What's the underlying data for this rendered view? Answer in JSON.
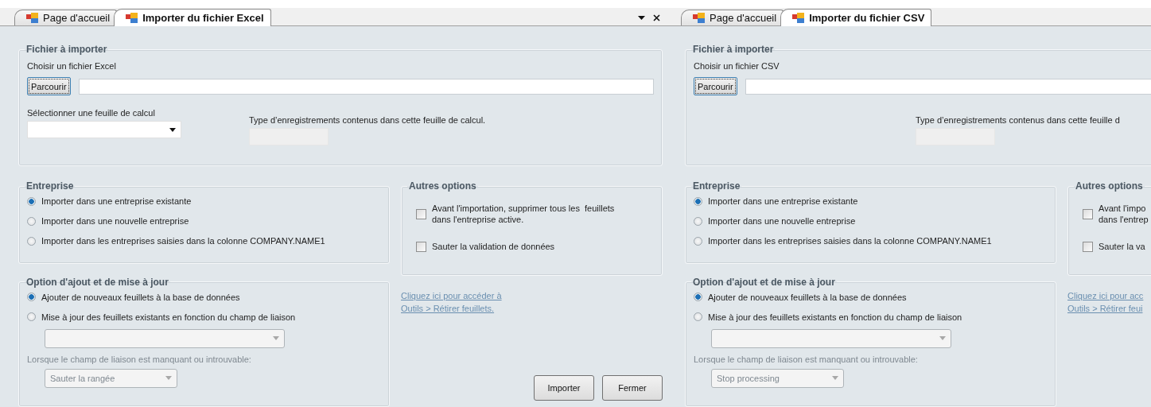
{
  "panels": [
    {
      "tabs": [
        {
          "label": "Page d'accueil",
          "selected": false
        },
        {
          "label": "Importer du fichier Excel",
          "selected": true
        }
      ],
      "tab_controls": true,
      "file_group": {
        "title": "Fichier à importer",
        "choose_label": "Choisir un fichier Excel",
        "browse_button": "Parcourir",
        "sheet_label": "Sélectionner une feuille de calcul",
        "record_type_label": "Type d’enregistrements contenus dans cette feuille de calcul."
      },
      "company_group": {
        "title": "Entreprise",
        "options": [
          {
            "label": "Importer dans une entreprise existante",
            "selected": true
          },
          {
            "label": "Importer dans une nouvelle entreprise",
            "selected": false
          },
          {
            "label": "Importer dans les entreprises saisies dans la colonne COMPANY.NAME1",
            "selected": false
          }
        ]
      },
      "other_options": {
        "title": "Autres options",
        "checkboxes": [
          {
            "lines": [
              "Avant l'importation, supprimer tous les  feuillets",
              "dans l'entreprise active."
            ],
            "checked": false
          },
          {
            "lines": [
              "Sauter la validation de données"
            ],
            "checked": false
          }
        ]
      },
      "update_group": {
        "title": "Option d'ajout et de mise à jour",
        "options": [
          {
            "label": "Ajouter de nouveaux feuillets à la base de données",
            "selected": true
          },
          {
            "label": "Mise à jour des feuillets existants en fonction du champ de liaison",
            "selected": false
          }
        ],
        "missing_label": "Lorsque le champ de liaison est manquant ou introuvable:",
        "missing_action": "Sauter la rangée"
      },
      "link_lines": [
        "Cliquez ici pour accéder à",
        "Outils > Rétirer feuillets."
      ],
      "buttons": [
        "Importer",
        "Fermer"
      ]
    },
    {
      "tabs": [
        {
          "label": "Page d'accueil",
          "selected": false
        },
        {
          "label": "Importer du fichier CSV",
          "selected": true
        }
      ],
      "tab_controls": false,
      "file_group": {
        "title": "Fichier à importer",
        "choose_label": "Choisir un fichier CSV",
        "browse_button": "Parcourir",
        "record_type_label": "Type d’enregistrements contenus dans cette feuille d"
      },
      "company_group": {
        "title": "Entreprise",
        "options": [
          {
            "label": "Importer dans une entreprise existante",
            "selected": true
          },
          {
            "label": "Importer dans une nouvelle entreprise",
            "selected": false
          },
          {
            "label": "Importer dans les entreprises saisies dans la colonne COMPANY.NAME1",
            "selected": false
          }
        ]
      },
      "other_options": {
        "title": "Autres options",
        "checkboxes": [
          {
            "lines": [
              "Avant l'impo",
              "dans l'entrep"
            ],
            "checked": false
          },
          {
            "lines": [
              "Sauter la va"
            ],
            "checked": false
          }
        ]
      },
      "update_group": {
        "title": "Option d'ajout et de mise à jour",
        "options": [
          {
            "label": "Ajouter de nouveaux feuillets à la base de données",
            "selected": true
          },
          {
            "label": "Mise à jour des feuillets existants en fonction du champ de liaison",
            "selected": false
          }
        ],
        "missing_label": "Lorsque le champ de liaison est manquant ou introuvable:",
        "missing_action": "Stop processing"
      },
      "link_lines": [
        "Cliquez ici pour acc",
        "Outils > Rétirer feui"
      ]
    }
  ]
}
